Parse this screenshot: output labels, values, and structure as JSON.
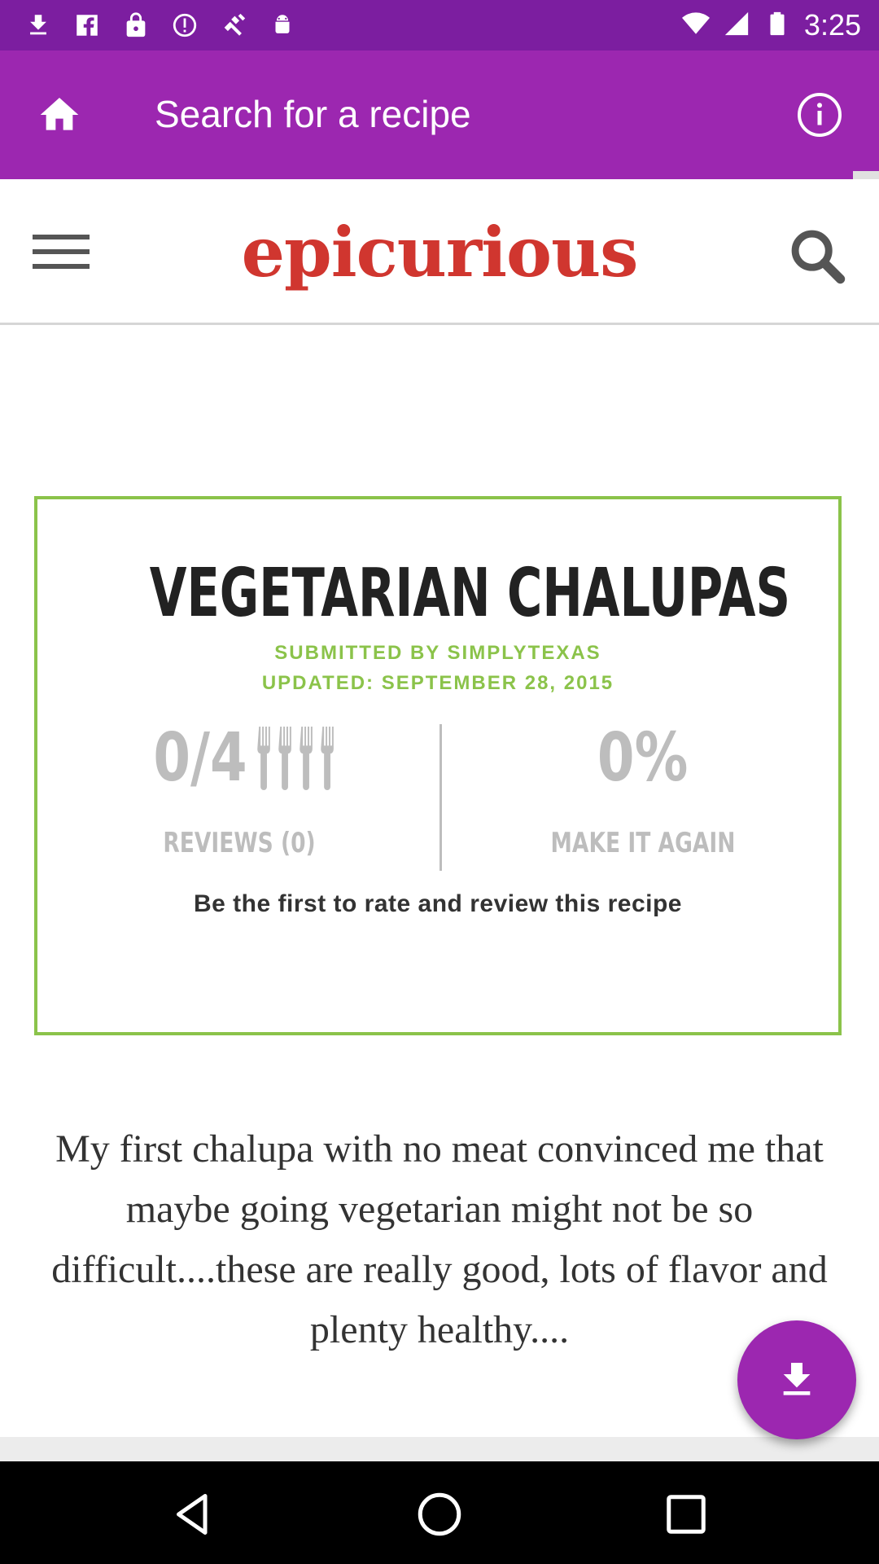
{
  "status_bar": {
    "time": "3:25",
    "left_icons": [
      "download-icon",
      "facebook-icon",
      "lock-icon",
      "alert-icon",
      "fake-gps-icon",
      "android-icon"
    ],
    "right_icons": [
      "wifi-icon",
      "signal-icon",
      "battery-icon"
    ]
  },
  "app_bar": {
    "title": "Search for a recipe",
    "background": "#9c27b0",
    "status_background": "#7c1ea0"
  },
  "web_header": {
    "logo": "epicurious",
    "logo_color": "#d0362f"
  },
  "recipe": {
    "title": "VEGETARIAN CHALUPAS",
    "submitted_by": "SUBMITTED BY SIMPLYTEXAS",
    "updated": "UPDATED: SEPTEMBER 28, 2015",
    "rating": "0/4",
    "reviews_label": "REVIEWS (0)",
    "make_it_again_value": "0%",
    "make_it_again_label": "MAKE IT AGAIN",
    "prompt": "Be the first to rate and review this recipe",
    "accent": "#8bc34a"
  },
  "description": "My first chalupa with no meat convinced me that maybe going vegetarian might not be so difficult....these are really good, lots of flavor and plenty healthy....",
  "fab": {
    "icon": "download-icon"
  },
  "nav_bar": {
    "buttons": [
      "back-icon",
      "home-icon",
      "recents-icon"
    ]
  }
}
